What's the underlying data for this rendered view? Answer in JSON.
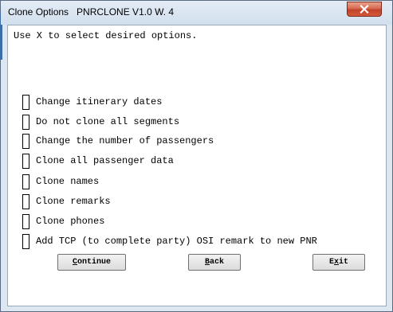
{
  "window": {
    "title": "Clone Options   PNRCLONE V1.0 W. 4",
    "close_icon": "close-x-icon"
  },
  "instruction": "Use X to select desired options.",
  "options": [
    {
      "label": "Change itinerary dates",
      "checked": false
    },
    {
      "label": "Do not clone all segments",
      "checked": false
    },
    {
      "label": "Change the number of passengers",
      "checked": false
    },
    {
      "label": "Clone all passenger data",
      "checked": false
    },
    {
      "label": "Clone names",
      "checked": false
    },
    {
      "label": "Clone remarks",
      "checked": false
    },
    {
      "label": "Clone phones",
      "checked": false
    },
    {
      "label": "Add TCP (to complete party) OSI remark to new PNR",
      "checked": false
    }
  ],
  "buttons": {
    "continue": {
      "mnemonic": "C",
      "rest": "ontinue"
    },
    "back": {
      "mnemonic": "B",
      "rest": "ack"
    },
    "exit": {
      "pre": "E",
      "mnemonic": "x",
      "rest": "it"
    }
  },
  "colors": {
    "frame": "#dde7f1",
    "close_button": "#c2412a"
  }
}
